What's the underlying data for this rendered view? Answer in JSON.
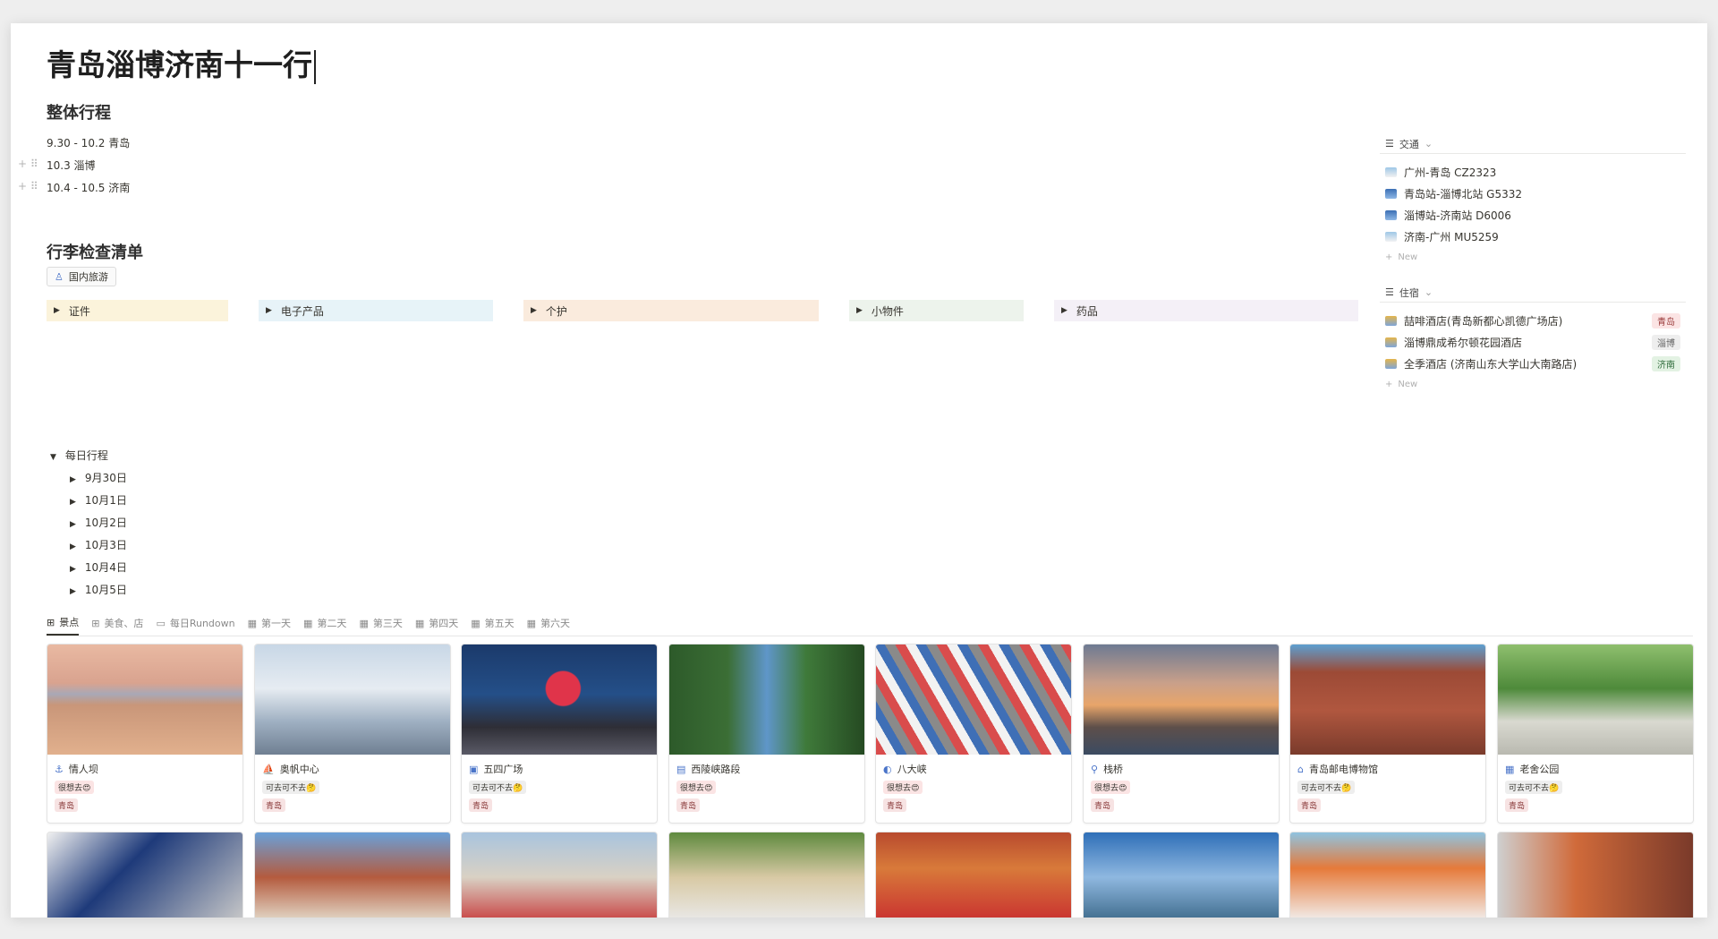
{
  "title": "青岛淄博济南十一行",
  "itinerary": {
    "heading": "整体行程",
    "items": [
      "9.30 - 10.2 青岛",
      "10.3 淄博",
      "10.4 - 10.5 济南"
    ]
  },
  "packing": {
    "heading": "行李检查清单",
    "tag": "国内旅游",
    "toggles": [
      {
        "label": "证件",
        "color": "#fbf3db"
      },
      {
        "label": "电子产品",
        "color": "#e7f3f8"
      },
      {
        "label": "个护",
        "color": "#faebdd"
      },
      {
        "label": "小物件",
        "color": "#edf3ec"
      },
      {
        "label": "药品",
        "color": "#f4f0f7"
      }
    ]
  },
  "daily": {
    "heading": "每日行程",
    "days": [
      "9月30日",
      "10月1日",
      "10月2日",
      "10月3日",
      "10月4日",
      "10月5日"
    ]
  },
  "transport": {
    "heading": "交通",
    "items": [
      "广州-青岛 CZ2323",
      "青岛站-淄博北站 G5332",
      "淄博站-济南站 D6006",
      "济南-广州 MU5259"
    ],
    "new_label": "New"
  },
  "lodging": {
    "heading": "住宿",
    "items": [
      {
        "name": "喆啡酒店(青岛新都心凯德广场店)",
        "city": "青岛",
        "bg": "#fbe4e4",
        "fg": "#9b3b3b"
      },
      {
        "name": "淄博鼎成希尔顿花园酒店",
        "city": "淄博",
        "bg": "#eeeeee",
        "fg": "#666666"
      },
      {
        "name": "全季酒店 (济南山东大学山大南路店)",
        "city": "济南",
        "bg": "#e3f2e3",
        "fg": "#2e6b3a"
      }
    ],
    "new_label": "New"
  },
  "tabs": [
    "景点",
    "美食、店",
    "每日Rundown",
    "第一天",
    "第二天",
    "第三天",
    "第四天",
    "第五天",
    "第六天"
  ],
  "cards": [
    {
      "name": "情人坝",
      "want": "很想去😍",
      "city": "青岛",
      "icon": "anchor-icon",
      "glyph": "⚓",
      "img": "breakwater"
    },
    {
      "name": "奥帆中心",
      "want": "可去可不去🤔",
      "city": "青岛",
      "icon": "sail-icon",
      "glyph": "⛵",
      "img": "sails"
    },
    {
      "name": "五四广场",
      "want": "可去可不去🤔",
      "city": "青岛",
      "icon": "square-icon",
      "glyph": "▣",
      "img": "night"
    },
    {
      "name": "西陵峡路段",
      "want": "很想去😍",
      "city": "青岛",
      "icon": "road-icon",
      "glyph": "▤",
      "img": "trees"
    },
    {
      "name": "八大峡",
      "want": "很想去😍",
      "city": "青岛",
      "icon": "wave-icon",
      "glyph": "◐",
      "img": "pier"
    },
    {
      "name": "栈桥",
      "want": "很想去😍",
      "city": "青岛",
      "icon": "bridge-icon",
      "glyph": "⚲",
      "img": "sunset"
    },
    {
      "name": "青岛邮电博物馆",
      "want": "可去可不去🤔",
      "city": "青岛",
      "icon": "museum-icon",
      "glyph": "⌂",
      "img": "brick"
    },
    {
      "name": "老舍公园",
      "want": "可去可不去🤔",
      "city": "青岛",
      "icon": "park-icon",
      "glyph": "▦",
      "img": "park"
    }
  ],
  "want_colors": {
    "很想去😍": "#fbe4e4",
    "可去可不去🤔": "#eeeeee"
  }
}
